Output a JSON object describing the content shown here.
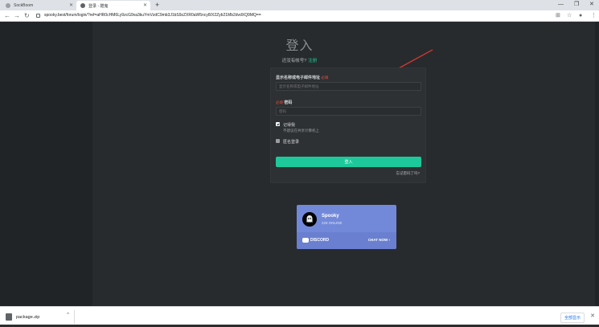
{
  "browser": {
    "tabs": [
      {
        "title": "SockBoom",
        "active": false
      },
      {
        "title": "登录 - 酷鬼",
        "active": true
      }
    ],
    "url": "spooky.best/forum/login/?ref=aHR0cHM6Ly9zcG9va3kuYmVzdC9mb3J1bS9zZXR0aW5ncy8/X2Zyb21Mb2dvdXQ9MQ=="
  },
  "login": {
    "title": "登入",
    "no_account_text": "还没有帐号?",
    "register_link": "注册",
    "username_label": "显示名称或电子邮件地址",
    "username_required": "必填",
    "username_placeholder": "显示名称或电子邮件地址",
    "password_required": "必填",
    "password_label": "密码",
    "password_placeholder": "密码",
    "remember_label": "记得我",
    "remember_hint": "不建议在共享计算机上",
    "anonymous_label": "匿名登录",
    "submit_label": "登入",
    "forgot_link": "忘记密码了吗?"
  },
  "discord_widget": {
    "server_name": "Spooky",
    "online_count": "229 ONLINE",
    "brand": "DISCORD",
    "cta": "CHAT NOW"
  },
  "downloads": {
    "file_name": "package.zip",
    "show_all_label": "全部显示"
  },
  "colors": {
    "accent": "#1dc99a",
    "required": "#e74c3c",
    "discord": "#7289da",
    "arrow": "#e53935"
  },
  "icons": [
    "back-icon",
    "forward-icon",
    "reload-icon",
    "lock-icon",
    "translate-icon",
    "star-icon",
    "profile-icon",
    "menu-icon",
    "checkbox-icon",
    "ghost-icon",
    "chevron-right-icon",
    "archive-icon",
    "close-icon"
  ]
}
